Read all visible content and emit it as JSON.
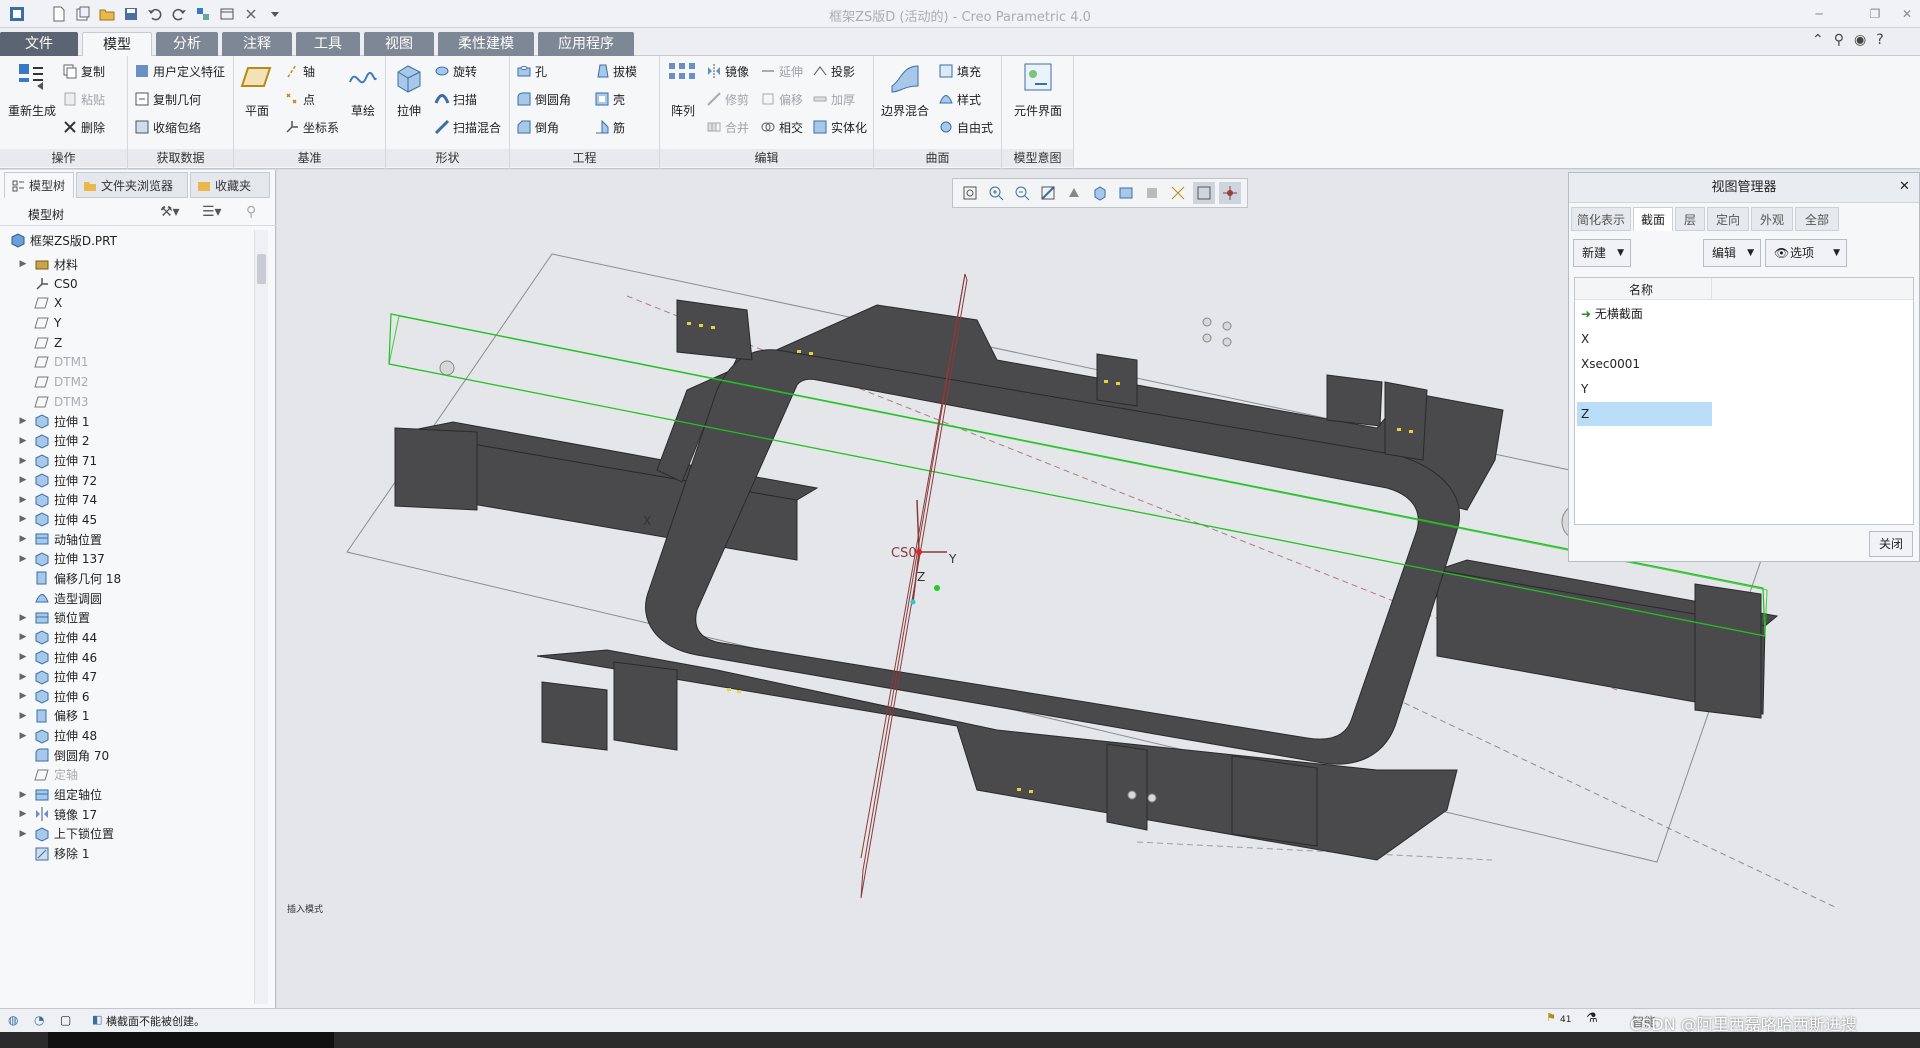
{
  "window": {
    "title": "框架ZS版D (活动的) - Creo Parametric 4.0"
  },
  "menu_tabs": [
    "文件",
    "模型",
    "分析",
    "注释",
    "工具",
    "视图",
    "柔性建模",
    "应用程序"
  ],
  "active_tab": "模型",
  "ribbon": {
    "ops": {
      "regen": "重新生成",
      "copy": "复制",
      "paste": "粘贴",
      "delete": "删除",
      "label": "操作"
    },
    "get": {
      "udf": "用户定义特征",
      "copygeom": "复制几何",
      "shrink": "收缩包络",
      "label": "获取数据"
    },
    "datum": {
      "plane": "平面",
      "axis": "轴",
      "point": "点",
      "csys": "坐标系",
      "sketch": "草绘",
      "label": "基准"
    },
    "shape": {
      "extrude": "拉伸",
      "revolve": "旋转",
      "sweep": "扫描",
      "blend": "扫描混合",
      "label": "形状"
    },
    "eng": {
      "hole": "孔",
      "round": "倒圆角",
      "chamfer": "倒角",
      "draft": "拔模",
      "shell": "壳",
      "rib": "筋",
      "label": "工程"
    },
    "edit": {
      "pattern": "阵列",
      "mirror": "镜像",
      "extend": "延伸",
      "project": "投影",
      "trim": "修剪",
      "offset": "偏移",
      "thicken": "加厚",
      "merge": "合并",
      "intersect": "相交",
      "solidify": "实体化",
      "label": "编辑"
    },
    "surface": {
      "boundary": "边界混合",
      "fill": "填充",
      "style": "样式",
      "freestyle": "自由式",
      "label": "曲面"
    },
    "intent": {
      "compif": "元件界面",
      "label": "模型意图"
    }
  },
  "panel_tabs": [
    "模型树",
    "文件夹浏览器",
    "收藏夹"
  ],
  "tree_title": "模型树",
  "tree_root": "框架ZS版D.PRT",
  "tree_items": [
    {
      "label": "材料",
      "exp": true,
      "dim": false,
      "icon": "material"
    },
    {
      "label": "CS0",
      "exp": false,
      "dim": false,
      "icon": "csys"
    },
    {
      "label": "X",
      "exp": false,
      "dim": false,
      "icon": "plane"
    },
    {
      "label": "Y",
      "exp": false,
      "dim": false,
      "icon": "plane"
    },
    {
      "label": "Z",
      "exp": false,
      "dim": false,
      "icon": "plane"
    },
    {
      "label": "DTM1",
      "exp": false,
      "dim": true,
      "icon": "plane"
    },
    {
      "label": "DTM2",
      "exp": false,
      "dim": true,
      "icon": "plane"
    },
    {
      "label": "DTM3",
      "exp": false,
      "dim": true,
      "icon": "plane"
    },
    {
      "label": "拉伸 1",
      "exp": true,
      "dim": false,
      "icon": "extrude"
    },
    {
      "label": "拉伸 2",
      "exp": true,
      "dim": false,
      "icon": "extrude"
    },
    {
      "label": "拉伸 71",
      "exp": true,
      "dim": false,
      "icon": "extrude"
    },
    {
      "label": "拉伸 72",
      "exp": true,
      "dim": false,
      "icon": "extrude"
    },
    {
      "label": "拉伸 74",
      "exp": true,
      "dim": false,
      "icon": "extrude"
    },
    {
      "label": "拉伸 45",
      "exp": true,
      "dim": false,
      "icon": "extrude"
    },
    {
      "label": "动轴位置",
      "exp": true,
      "dim": false,
      "icon": "group"
    },
    {
      "label": "拉伸 137",
      "exp": true,
      "dim": false,
      "icon": "extrude"
    },
    {
      "label": "偏移几何 18",
      "exp": false,
      "dim": false,
      "icon": "offset"
    },
    {
      "label": "造型调圆",
      "exp": false,
      "dim": false,
      "icon": "style"
    },
    {
      "label": "锁位置",
      "exp": true,
      "dim": false,
      "icon": "group"
    },
    {
      "label": "拉伸 44",
      "exp": true,
      "dim": false,
      "icon": "extrude"
    },
    {
      "label": "拉伸 46",
      "exp": true,
      "dim": false,
      "icon": "extrude"
    },
    {
      "label": "拉伸 47",
      "exp": true,
      "dim": false,
      "icon": "extrude"
    },
    {
      "label": "拉伸 6",
      "exp": true,
      "dim": false,
      "icon": "extrude"
    },
    {
      "label": "偏移 1",
      "exp": true,
      "dim": false,
      "icon": "offset"
    },
    {
      "label": "拉伸 48",
      "exp": true,
      "dim": false,
      "icon": "extrude"
    },
    {
      "label": "倒圆角 70",
      "exp": false,
      "dim": false,
      "icon": "round"
    },
    {
      "label": "定轴",
      "exp": false,
      "dim": true,
      "icon": "plane"
    },
    {
      "label": "组定轴位",
      "exp": true,
      "dim": false,
      "icon": "group"
    },
    {
      "label": "镜像 17",
      "exp": true,
      "dim": false,
      "icon": "mirror"
    },
    {
      "label": "上下锁位置",
      "exp": true,
      "dim": false,
      "icon": "extrude"
    },
    {
      "label": "移除 1",
      "exp": false,
      "dim": false,
      "icon": "remove"
    }
  ],
  "viewport": {
    "mode_label": "插入模式",
    "csys_label": "CS0",
    "axis_x": "X",
    "axis_y": "Y",
    "axis_z": "Z"
  },
  "view_manager": {
    "title": "视图管理器",
    "tabs": [
      "简化表示",
      "截面",
      "层",
      "定向",
      "外观",
      "全部"
    ],
    "active_tab": "截面",
    "new_btn": "新建",
    "edit_btn": "编辑",
    "options_btn": "选项",
    "col_header": "名称",
    "items": [
      "无横截面",
      "X",
      "Xsec0001",
      "Y",
      "Z"
    ],
    "selected": "Z",
    "close_btn": "关闭"
  },
  "status": {
    "message": "横截面不能被创建。",
    "filter": "智能",
    "watermark": "CSDN @阿里西磊咯哈西斯进搜",
    "count": "41"
  },
  "colors": {
    "accent": "#7e8795",
    "selection": "#b9dcf7",
    "model": "#4a4a4c",
    "section": "#22c222"
  }
}
